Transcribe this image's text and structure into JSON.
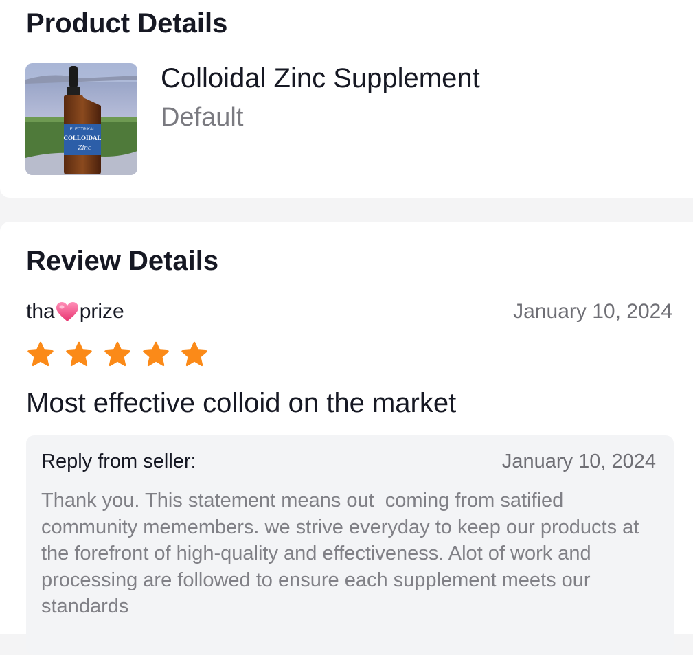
{
  "product_section": {
    "title": "Product Details",
    "product_name": "Colloidal Zinc Supplement",
    "variant": "Default",
    "image_alt": "Colloidal Zinc bottle photo",
    "image_label_small": "ELECTRIKAL",
    "image_label_main": "COLLOIDAL",
    "image_label_sub": "Zinc"
  },
  "review_section": {
    "title": "Review Details",
    "reviewer_prefix": "tha",
    "reviewer_suffix": "prize",
    "reviewer_emoji_icon": "heart-icon",
    "date": "January 10, 2024",
    "rating": 5,
    "max_rating": 5,
    "star_color": "#fb8a18",
    "review_title": "Most effective colloid on the market",
    "reply": {
      "label": "Reply from seller:",
      "date": "January 10, 2024",
      "text": "Thank you. This statement means out  coming from satified community memembers. we strive everyday to keep our products at the forefront of high-quality and effectiveness. Alot of work and processing are followed to ensure each supplement meets our standards"
    }
  }
}
